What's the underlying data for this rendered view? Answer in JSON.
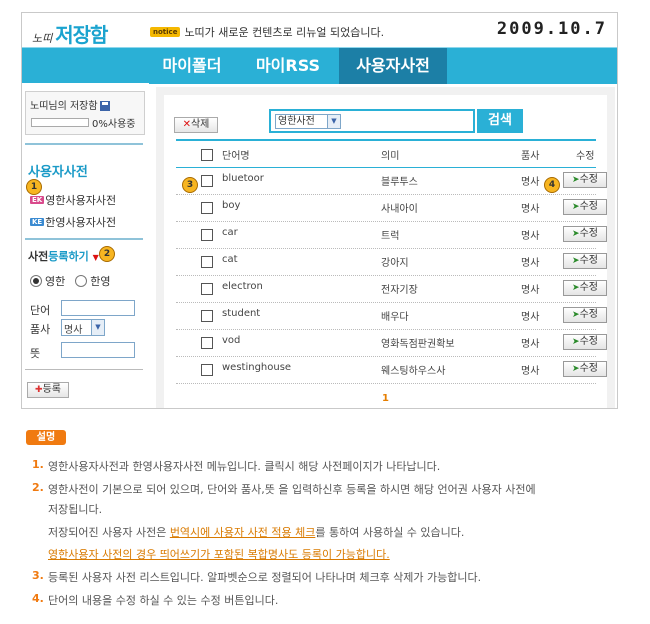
{
  "header": {
    "brand_small": "노띠",
    "brand_big": "저장함",
    "notice_badge": "notice",
    "notice_text": "노띠가 새로운 컨텐츠로 리뉴얼 되었습니다.",
    "date": "2009.10.7"
  },
  "tabs": [
    {
      "label": "마이폴더",
      "active": false
    },
    {
      "label": "마이RSS",
      "active": false
    },
    {
      "label": "사용자사전",
      "active": true
    }
  ],
  "sidebar": {
    "storage_label": "노띠님의 저장함",
    "storage_percent": "0%사용중",
    "storage_used_fraction": 0,
    "section_title": "사용자사전",
    "dict_links": [
      {
        "icon": "EK",
        "label": "영한사용자사전"
      },
      {
        "icon": "KE",
        "label": "한영사용자사전"
      }
    ],
    "register": {
      "title_a": "사전",
      "title_b": "등록하기",
      "radio_options": [
        "영한",
        "한영"
      ],
      "radio_selected": "영한",
      "word_label": "단어",
      "pos_label": "품사",
      "pos_value": "명사",
      "meaning_label": "뜻",
      "submit_label": "등록"
    }
  },
  "main": {
    "delete_label": "삭제",
    "search_select": "영한사전",
    "search_button": "검색",
    "columns": [
      "단어명",
      "의미",
      "품사",
      "수정"
    ],
    "rows": [
      {
        "word": "bluetoor",
        "meaning": "블루투스",
        "pos": "명사",
        "edit": "수정"
      },
      {
        "word": "boy",
        "meaning": "사내아이",
        "pos": "명사",
        "edit": "수정"
      },
      {
        "word": "car",
        "meaning": "트럭",
        "pos": "명사",
        "edit": "수정"
      },
      {
        "word": "cat",
        "meaning": "강아지",
        "pos": "명사",
        "edit": "수정"
      },
      {
        "word": "electron",
        "meaning": "전자기장",
        "pos": "명사",
        "edit": "수정"
      },
      {
        "word": "student",
        "meaning": "배우다",
        "pos": "명사",
        "edit": "수정"
      },
      {
        "word": "vod",
        "meaning": "영화독점판권확보",
        "pos": "명사",
        "edit": "수정"
      },
      {
        "word": "westinghouse",
        "meaning": "웨스팅하우스사",
        "pos": "명사",
        "edit": "수정"
      }
    ],
    "page": "1"
  },
  "callouts": [
    "1",
    "2",
    "3",
    "4"
  ],
  "description": {
    "title": "설명",
    "items": [
      {
        "num": "1.",
        "lines": [
          "영한사용자사전과 한영사용자사전 메뉴입니다. 클릭시 해당 사전페이지가 나타납니다."
        ]
      },
      {
        "num": "2.",
        "lines": [
          "영한사전이 기본으로 되어 있으며, 단어와 품사,뜻 을 입력하신후 등록을 하시면 해당 언어권 사용자 사전에",
          "저장됩니다."
        ]
      },
      {
        "num": "",
        "lines": []
      },
      {
        "num": "3.",
        "lines": [
          "등록된 사용자 사전 리스트입니다. 알파벳순으로 정렬되어 나타나며 체크후 삭제가 가능합니다."
        ]
      },
      {
        "num": "4.",
        "lines": [
          "단어의 내용을 수정 하실 수 있는 수정 버튼입니다."
        ]
      }
    ],
    "note_a": "저장되어진 사용자 사전은 ",
    "note_a_link": "번역시에 사용자 사전 적용 체크",
    "note_a_end": "를 통하여 사용하실 수 있습니다.",
    "note_b_link": "영한사용자 사전의 경우 띄어쓰기가 포함된 복합명사도 등록이 가능합니다."
  },
  "colors": {
    "accent": "#2ab0d6",
    "active_tab": "#1c7fa6",
    "orange": "#f07a10"
  }
}
